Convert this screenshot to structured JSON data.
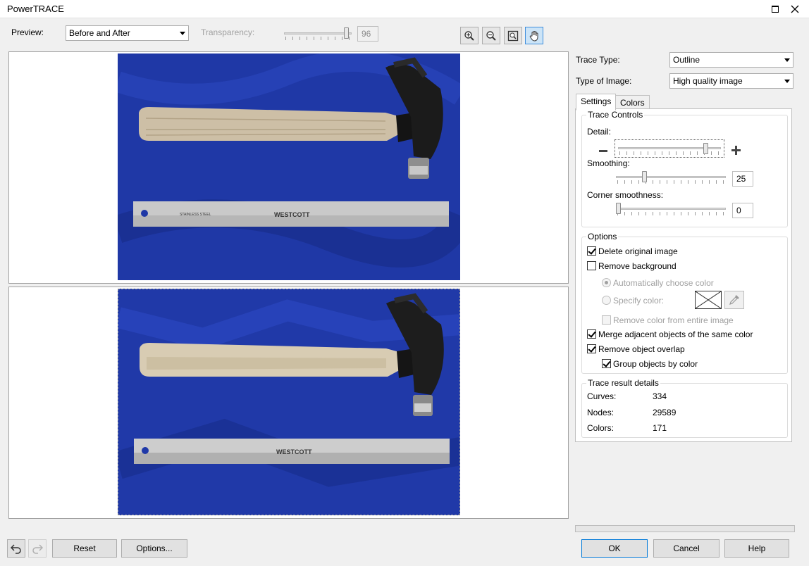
{
  "window": {
    "title": "PowerTRACE"
  },
  "preview_bar": {
    "preview_label": "Preview:",
    "preview_value": "Before and After",
    "transparency_label": "Transparency:",
    "transparency_value": "96",
    "transparency_level": 0.96
  },
  "tools": [
    "zoom-in-icon",
    "zoom-out-icon",
    "fit-to-window-icon",
    "pan-hand-icon"
  ],
  "trace": {
    "trace_type_label": "Trace Type:",
    "trace_type_value": "Outline",
    "image_type_label": "Type of Image:",
    "image_type_value": "High quality image"
  },
  "tabs": [
    {
      "label": "Settings"
    },
    {
      "label": "Colors"
    }
  ],
  "trace_controls": {
    "title": "Trace Controls",
    "detail_label": "Detail:",
    "detail_level": 0.87,
    "smoothing_label": "Smoothing:",
    "smoothing_value": "25",
    "smoothing_level": 0.25,
    "corner_label": "Corner smoothness:",
    "corner_value": "0",
    "corner_level": 0.0
  },
  "options": {
    "title": "Options",
    "delete_original": "Delete original image",
    "remove_background": "Remove background",
    "auto_color": "Automatically choose color",
    "specify_color": "Specify color:",
    "remove_color_entire": "Remove color from entire image",
    "merge_adjacent": "Merge adjacent objects of the same color",
    "remove_overlap": "Remove object overlap",
    "group_by_color": "Group objects by color"
  },
  "result": {
    "title": "Trace result details",
    "curves_label": "Curves:",
    "curves_value": "334",
    "nodes_label": "Nodes:",
    "nodes_value": "29589",
    "colors_label": "Colors:",
    "colors_value": "171"
  },
  "ruler_brand": "WESTCOTT",
  "ruler_text": "STAINLESS STEEL",
  "buttons": {
    "reset": "Reset",
    "options": "Options...",
    "ok": "OK",
    "cancel": "Cancel",
    "help": "Help"
  },
  "colors": {
    "photo_blue": "#1f38a6",
    "accent": "#0078d7"
  }
}
